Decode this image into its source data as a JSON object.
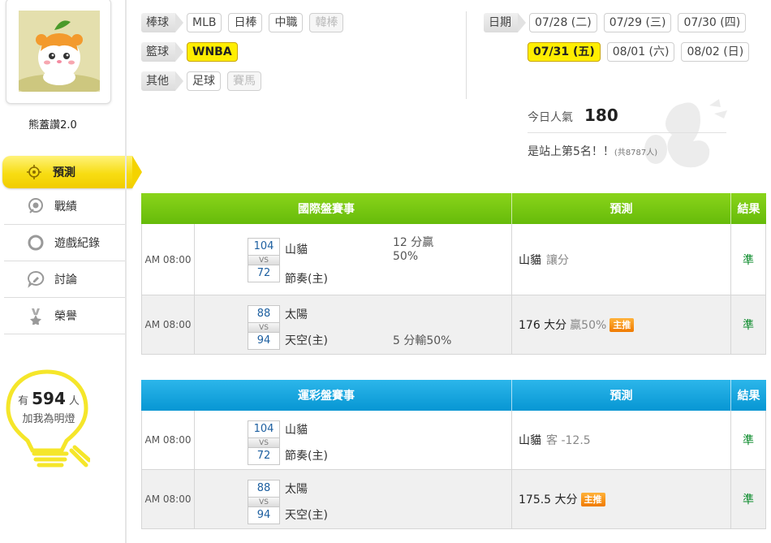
{
  "sidebar": {
    "username": "熊蓋讚2.0",
    "nav": [
      {
        "label": "預測",
        "icon": "target-icon",
        "active": true
      },
      {
        "label": "戰績",
        "icon": "record-icon",
        "active": false
      },
      {
        "label": "遊戲紀錄",
        "icon": "circle-icon",
        "active": false
      },
      {
        "label": "討論",
        "icon": "chat-pencil-icon",
        "active": false
      },
      {
        "label": "榮譽",
        "icon": "medal-icon",
        "active": false
      }
    ],
    "fans": {
      "prefix": "有",
      "count": "594",
      "suffix": "人",
      "caption": "加我為明燈"
    }
  },
  "filters": {
    "baseball": {
      "label": "棒球",
      "options": [
        "MLB",
        "日棒",
        "中職",
        "韓棒"
      ]
    },
    "basketball": {
      "label": "籃球",
      "options": [
        "WNBA"
      ]
    },
    "other": {
      "label": "其他",
      "options": [
        "足球",
        "賽馬"
      ]
    },
    "date": {
      "label": "日期",
      "row1": [
        "07/28 (二)",
        "07/29 (三)",
        "07/30 (四)"
      ],
      "row2": [
        "07/31 (五)",
        "08/01 (六)",
        "08/02 (日)"
      ]
    }
  },
  "popularity": {
    "label": "今日人氣",
    "count": "180",
    "rank_text": "是站上第5名！！",
    "total": "(共8787人)"
  },
  "table_intl": {
    "headers": {
      "game": "國際盤賽事",
      "pred": "預測",
      "result": "結果"
    },
    "rows": [
      {
        "time": "AM 08:00",
        "score_top": "104",
        "vs": "VS",
        "score_bottom": "72",
        "team_top": "山貓",
        "team_bottom": "節奏(主)",
        "note_line1": "12 分贏",
        "note_line2": "50%",
        "pred_main": "山貓",
        "pred_sub": "讓分",
        "badge": "",
        "result": "準"
      },
      {
        "time": "AM 08:00",
        "score_top": "88",
        "vs": "VS",
        "score_bottom": "94",
        "team_top": "太陽",
        "team_bottom": "天空(主)",
        "note_line1": "",
        "note_line2": "5 分輸50%",
        "pred_main": "176 大分",
        "pred_sub": "贏50%",
        "badge": "主推",
        "result": "準"
      }
    ]
  },
  "table_lottery": {
    "headers": {
      "game": "運彩盤賽事",
      "pred": "預測",
      "result": "結果"
    },
    "rows": [
      {
        "time": "AM 08:00",
        "score_top": "104",
        "vs": "VS",
        "score_bottom": "72",
        "team_top": "山貓",
        "team_bottom": "節奏(主)",
        "pred_main": "山貓",
        "pred_sub": "客 -12.5",
        "badge": "",
        "result": "準"
      },
      {
        "time": "AM 08:00",
        "score_top": "88",
        "vs": "VS",
        "score_bottom": "94",
        "team_top": "太陽",
        "team_bottom": "天空(主)",
        "pred_main": "175.5 大分",
        "pred_sub": "",
        "badge": "主推",
        "result": "準"
      }
    ]
  },
  "colors": {
    "accent_yellow": "#ffee00",
    "header_green": "#66bb0a",
    "header_blue": "#0796d3",
    "result_green": "#0a8a2a",
    "badge_orange": "#f07a00"
  }
}
